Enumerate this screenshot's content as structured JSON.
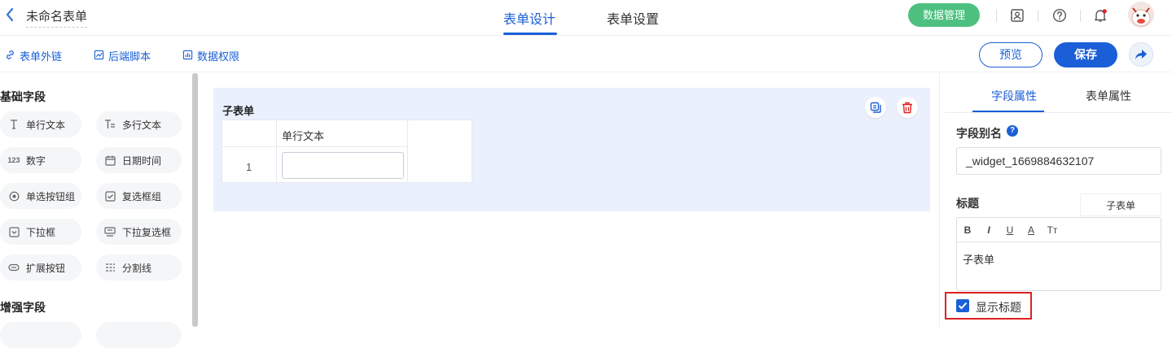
{
  "header": {
    "back_icon": "chevron-left-icon",
    "form_title": "未命名表单",
    "tabs": [
      {
        "label": "表单设计",
        "active": true
      },
      {
        "label": "表单设置",
        "active": false
      }
    ],
    "data_manage_label": "数据管理",
    "icons": [
      "contact-card-icon",
      "help-circle-icon",
      "bell-icon"
    ]
  },
  "toolbar": {
    "links": [
      {
        "label": "表单外链",
        "icon": "link-icon"
      },
      {
        "label": "后端脚本",
        "icon": "script-icon"
      },
      {
        "label": "数据权限",
        "icon": "chart-icon"
      }
    ],
    "preview_label": "预览",
    "save_label": "保存"
  },
  "left_panel": {
    "basic_title": "基础字段",
    "basic_fields": [
      {
        "label": "单行文本",
        "icon": "text-cursor-icon"
      },
      {
        "label": "多行文本",
        "icon": "multiline-text-icon"
      },
      {
        "label": "数字",
        "icon": "number-icon",
        "glyph": "123"
      },
      {
        "label": "日期时间",
        "icon": "calendar-icon"
      },
      {
        "label": "单选按钮组",
        "icon": "radio-icon"
      },
      {
        "label": "复选框组",
        "icon": "checkbox-group-icon"
      },
      {
        "label": "下拉框",
        "icon": "dropdown-icon"
      },
      {
        "label": "下拉复选框",
        "icon": "dropdown-multi-icon"
      },
      {
        "label": "扩展按钮",
        "icon": "button-icon"
      },
      {
        "label": "分割线",
        "icon": "divider-icon"
      }
    ],
    "enhanced_title": "增强字段"
  },
  "canvas": {
    "subform_title": "子表单",
    "column_header": "单行文本",
    "row_number": "1"
  },
  "right_panel": {
    "tabs": [
      {
        "label": "字段属性",
        "active": true
      },
      {
        "label": "表单属性",
        "active": false
      }
    ],
    "alias_label": "字段别名",
    "alias_value": "_widget_1669884632107",
    "title_label": "标题",
    "title_tag": "子表单",
    "editor_buttons": [
      "B",
      "I",
      "U",
      "A",
      "Tт"
    ],
    "editor_content": "子表单",
    "show_title_label": "显示标题",
    "show_title_checked": true
  },
  "colors": {
    "primary": "#1a5fd7",
    "green": "#4dc07f",
    "danger": "#e02020",
    "subform_bg": "#eaf0fc"
  }
}
